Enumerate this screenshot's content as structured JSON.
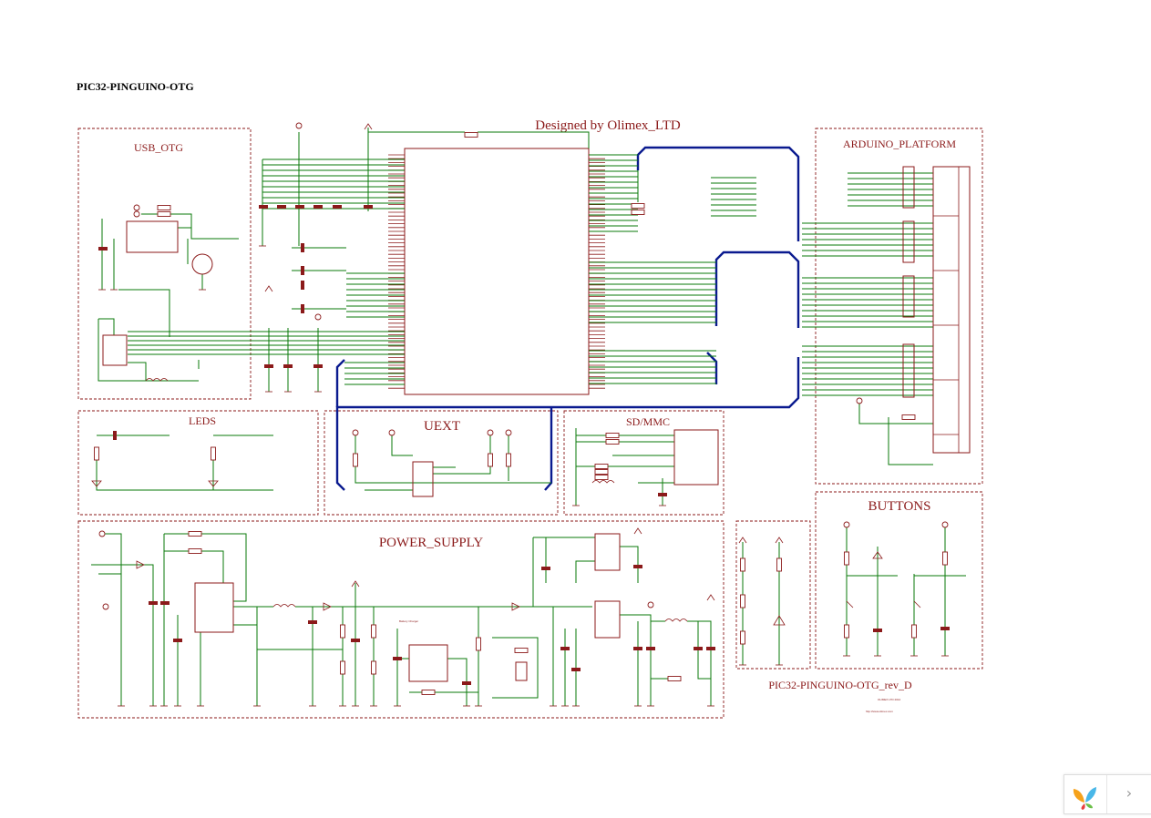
{
  "document": {
    "title": "PIC32-PINGUINO-OTG"
  },
  "schematic": {
    "designer": "Designed by Olimex_LTD",
    "revision": "PIC32-PINGUINO-OTG_rev_D",
    "copyright": "OLIMEX LTD 2012",
    "website": "http://www.olimex.com",
    "sections": {
      "usb_otg": "USB_OTG",
      "arduino": "ARDUINO_PLATFORM",
      "leds": "LEDS",
      "uext": "UEXT",
      "sdmmc": "SD/MMC",
      "power": "POWER_SUPPLY",
      "buttons": "BUTTONS",
      "battery_charger": "Battery Charger"
    },
    "colors": {
      "component": "#8b1a1a",
      "wire": "#0a7a0a",
      "bus": "#0a1a8f"
    }
  },
  "navigation": {
    "next_icon": "chevron-right-icon",
    "logo_icon": "leaf-logo-icon",
    "next_glyph": "›"
  }
}
